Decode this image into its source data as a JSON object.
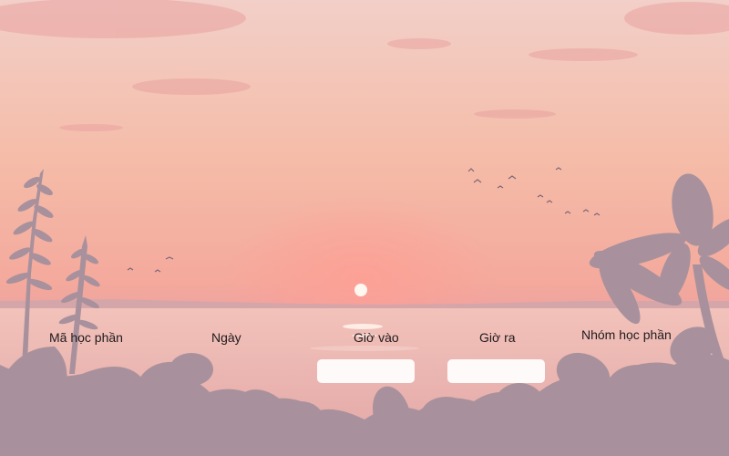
{
  "form": {
    "labels": {
      "course_code": "Mã học phần",
      "date": "Ngày",
      "time_in": "Giờ vào",
      "time_out": "Giờ ra",
      "course_group": "Nhóm học phần"
    },
    "fields": {
      "time_in_value": "",
      "time_out_value": ""
    }
  },
  "background": {
    "sky_top": "#f3cdc6",
    "sky_mid": "#f6b9a6",
    "horizon": "#f49a90",
    "sun": "#fff6ee",
    "sea": "#f0b6ad",
    "silhouette": "#a8919c"
  }
}
